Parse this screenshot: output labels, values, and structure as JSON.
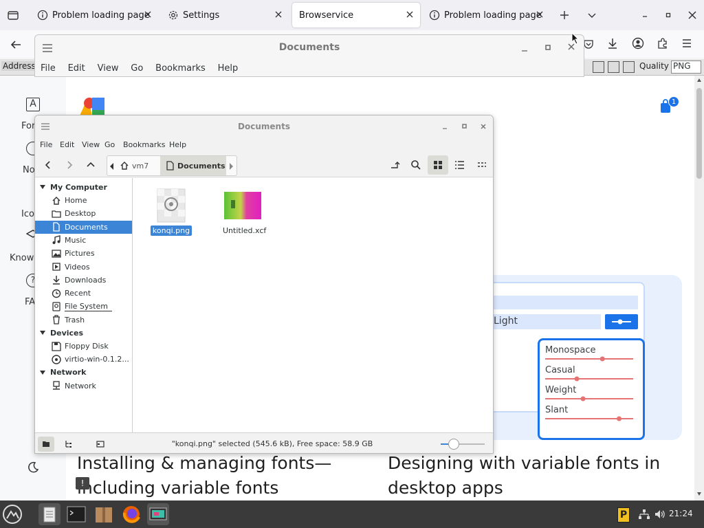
{
  "browser": {
    "tabs": [
      {
        "label": "Problem loading page",
        "icon": "info-icon"
      },
      {
        "label": "Settings",
        "icon": "gear-icon"
      },
      {
        "label": "Browservice",
        "icon": ""
      },
      {
        "label": "Problem loading page",
        "icon": "info-icon"
      }
    ],
    "address_label": "Address",
    "quality_label": "Quality",
    "format_value": "PNG"
  },
  "back_window": {
    "title": "Documents",
    "menu": [
      "File",
      "Edit",
      "View",
      "Go",
      "Bookmarks",
      "Help"
    ]
  },
  "window": {
    "title": "Documents",
    "menu": [
      "File",
      "Edit",
      "View",
      "Go",
      "Bookmarks",
      "Help"
    ],
    "breadcrumb": [
      "vm7",
      "Documents"
    ],
    "sidebar": {
      "sections": [
        {
          "header": "My Computer",
          "items": [
            {
              "label": "Home",
              "icon": "home-icon"
            },
            {
              "label": "Desktop",
              "icon": "folder-icon"
            },
            {
              "label": "Documents",
              "icon": "document-icon",
              "selected": true
            },
            {
              "label": "Music",
              "icon": "music-icon"
            },
            {
              "label": "Pictures",
              "icon": "picture-icon"
            },
            {
              "label": "Videos",
              "icon": "video-icon"
            },
            {
              "label": "Downloads",
              "icon": "download-icon"
            },
            {
              "label": "Recent",
              "icon": "clock-icon"
            },
            {
              "label": "File System",
              "icon": "drive-icon"
            },
            {
              "label": "Trash",
              "icon": "trash-icon"
            }
          ]
        },
        {
          "header": "Devices",
          "items": [
            {
              "label": "Floppy Disk",
              "icon": "floppy-icon"
            },
            {
              "label": "virtio-win-0.1.2...",
              "icon": "disc-icon"
            }
          ]
        },
        {
          "header": "Network",
          "items": [
            {
              "label": "Network",
              "icon": "network-icon"
            }
          ]
        }
      ]
    },
    "files": [
      {
        "name": "konqi.png",
        "selected": true
      },
      {
        "name": "Untitled.xcf",
        "selected": false
      }
    ],
    "status": "\"konqi.png\" selected (545.6 kB), Free space: 58.9 GB",
    "zoom_level": 0.3
  },
  "page": {
    "rail": [
      "For",
      "No",
      "Ico",
      "Knowl",
      "FA"
    ],
    "heading_left": [
      "Installing & managing fonts—",
      "including variable fonts"
    ],
    "heading_right": [
      "Designing with variable fonts in",
      "desktop apps"
    ],
    "badge_count": "1",
    "card": {
      "theme": "Light",
      "sliders": [
        {
          "label": "Monospace",
          "value": 0.65
        },
        {
          "label": "Casual",
          "value": 0.36
        },
        {
          "label": "Weight",
          "value": 0.43
        },
        {
          "label": "Slant",
          "value": 0.84
        }
      ]
    }
  },
  "taskbar": {
    "clock": "21:24"
  }
}
